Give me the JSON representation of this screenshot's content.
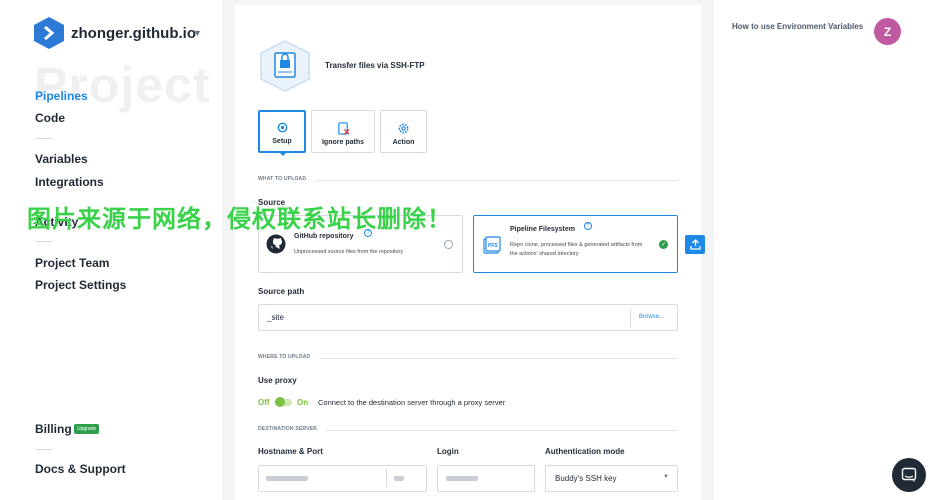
{
  "org": {
    "name": "zhonger.github.io"
  },
  "sidebar": {
    "watermark": "Project",
    "items": [
      {
        "label": "Pipelines",
        "active": true
      },
      {
        "label": "Code"
      },
      {
        "label": "Variables"
      },
      {
        "label": "Integrations"
      },
      {
        "label": "Activity"
      },
      {
        "label": "Project Team"
      },
      {
        "label": "Project Settings"
      },
      {
        "label": "Billing"
      },
      {
        "label": "Docs & Support"
      }
    ],
    "upgrade_badge": "Upgrade"
  },
  "overlay_text": "图片来源于网络，侵权联系站长删除！",
  "header": {
    "help_link": "How to use Environment Variables",
    "avatar_initial": "Z"
  },
  "action": {
    "title": "Transfer files via SSH-FTP"
  },
  "tabs": [
    {
      "label": "Setup",
      "active": true
    },
    {
      "label": "Ignore paths"
    },
    {
      "label": "Action"
    }
  ],
  "what_to_upload": {
    "section_label": "WHAT TO UPLOAD",
    "source_label": "Source",
    "options": [
      {
        "title": "GitHub repository",
        "description": "Unprocessed source files from the repository",
        "selected": false
      },
      {
        "title": "Pipeline Filesystem",
        "description": "Repo clone, processed files & generated artifacts from the actions' shared directory",
        "selected": true
      }
    ],
    "source_path_label": "Source path",
    "source_path_value": "_site",
    "browse_label": "Browse..."
  },
  "where_to_upload": {
    "section_label": "WHERE TO UPLOAD",
    "use_proxy_label": "Use proxy",
    "toggle_off": "Off",
    "toggle_on": "On",
    "proxy_description": "Connect to the destination server through a proxy server"
  },
  "destination": {
    "section_label": "DESTINATION SERVER",
    "hostname_label": "Hostname & Port",
    "login_label": "Login",
    "auth_label": "Authentication mode",
    "auth_value": "Buddy's SSH key"
  },
  "colors": {
    "accent": "#1e88e5",
    "success": "#2e9e4d",
    "toggle": "#7cc142",
    "avatar": "#c05aa0",
    "overlay": "#39d24a"
  }
}
